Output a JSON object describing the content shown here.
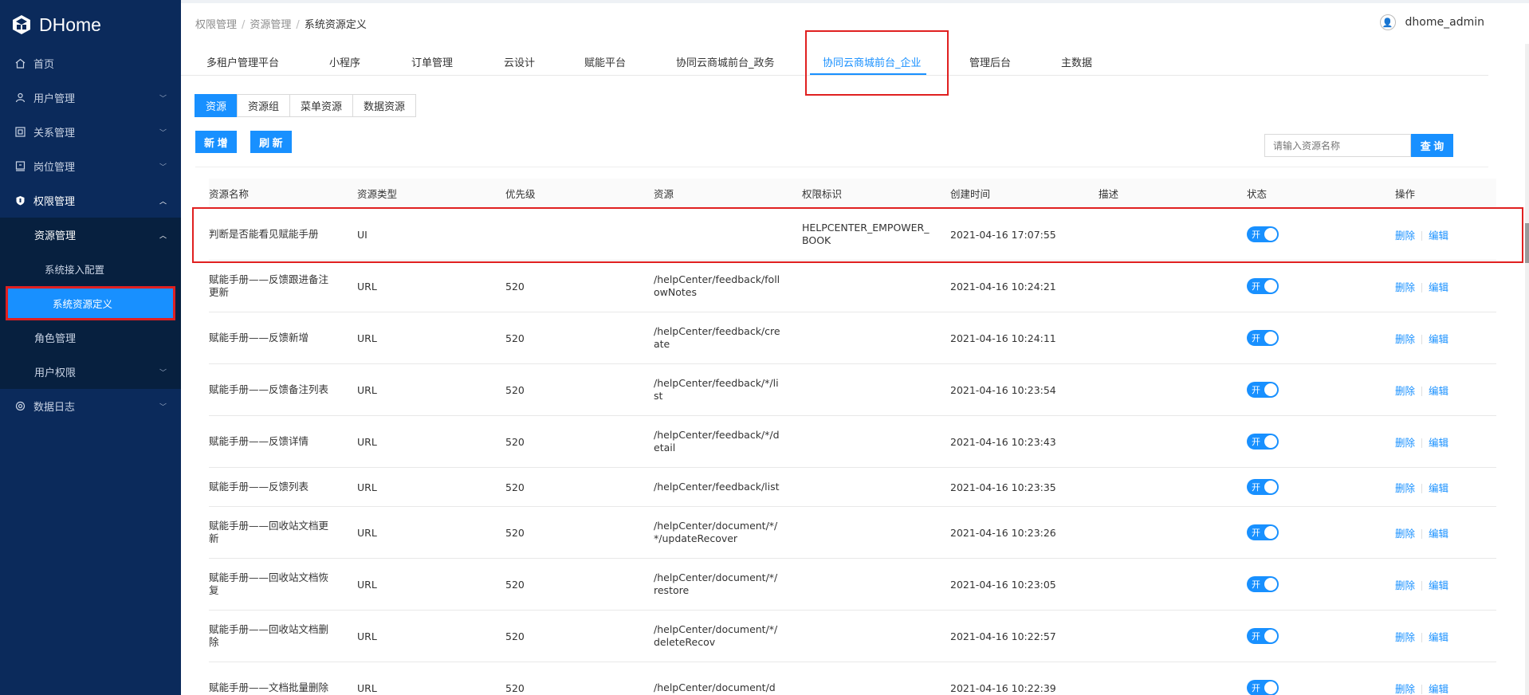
{
  "app": {
    "logo": "DHome"
  },
  "sidebar": {
    "items": [
      {
        "label": "首页",
        "icon": "home-icon"
      },
      {
        "label": "用户管理",
        "icon": "user-icon"
      },
      {
        "label": "关系管理",
        "icon": "relation-icon"
      },
      {
        "label": "岗位管理",
        "icon": "post-icon"
      },
      {
        "label": "权限管理",
        "icon": "shield-icon"
      },
      {
        "label": "资源管理"
      },
      {
        "label": "系统接入配置"
      },
      {
        "label": "系统资源定义"
      },
      {
        "label": "角色管理"
      },
      {
        "label": "用户权限"
      },
      {
        "label": "数据日志",
        "icon": "log-icon"
      }
    ]
  },
  "breadcrumb": {
    "b1": "权限管理",
    "b2": "资源管理",
    "b3": "系统资源定义"
  },
  "user": {
    "name": "dhome_admin"
  },
  "tabs": [
    "多租户管理平台",
    "小程序",
    "订单管理",
    "云设计",
    "赋能平台",
    "协同云商城前台_政务",
    "协同云商城前台_企业",
    "管理后台",
    "主数据"
  ],
  "segments": [
    "资源",
    "资源组",
    "菜单资源",
    "数据资源"
  ],
  "buttons": {
    "add": "新 增",
    "refresh": "刷 新",
    "query": "查 询"
  },
  "search": {
    "placeholder": "请输入资源名称"
  },
  "table": {
    "headers": [
      "资源名称",
      "资源类型",
      "优先级",
      "资源",
      "权限标识",
      "创建时间",
      "描述",
      "状态",
      "操作"
    ],
    "toggle_label": "开",
    "delete_label": "删除",
    "edit_label": "编辑",
    "rows": [
      {
        "name": [
          "判断是否能看见赋能手册"
        ],
        "type": "UI",
        "priority": "",
        "resource": [],
        "perm": [
          "HELPCENTER_EMPOWER_",
          "BOOK"
        ],
        "time": "2021-04-16 17:07:55"
      },
      {
        "name": [
          "赋能手册——反馈跟进备注",
          "更新"
        ],
        "type": "URL",
        "priority": "520",
        "resource": [
          "/helpCenter/feedback/foll",
          "owNotes"
        ],
        "perm": [],
        "time": "2021-04-16 10:24:21"
      },
      {
        "name": [
          "赋能手册——反馈新增"
        ],
        "type": "URL",
        "priority": "520",
        "resource": [
          "/helpCenter/feedback/cre",
          "ate"
        ],
        "perm": [],
        "time": "2021-04-16 10:24:11"
      },
      {
        "name": [
          "赋能手册——反馈备注列表"
        ],
        "type": "URL",
        "priority": "520",
        "resource": [
          "/helpCenter/feedback/*/li",
          "st"
        ],
        "perm": [],
        "time": "2021-04-16 10:23:54"
      },
      {
        "name": [
          "赋能手册——反馈详情"
        ],
        "type": "URL",
        "priority": "520",
        "resource": [
          "/helpCenter/feedback/*/d",
          "etail"
        ],
        "perm": [],
        "time": "2021-04-16 10:23:43"
      },
      {
        "name": [
          "赋能手册——反馈列表"
        ],
        "type": "URL",
        "priority": "520",
        "resource": [
          "/helpCenter/feedback/list"
        ],
        "perm": [],
        "time": "2021-04-16 10:23:35"
      },
      {
        "name": [
          "赋能手册——回收站文档更",
          "新"
        ],
        "type": "URL",
        "priority": "520",
        "resource": [
          "/helpCenter/document/*/",
          "*/updateRecover"
        ],
        "perm": [],
        "time": "2021-04-16 10:23:26"
      },
      {
        "name": [
          "赋能手册——回收站文档恢",
          "复"
        ],
        "type": "URL",
        "priority": "520",
        "resource": [
          "/helpCenter/document/*/",
          "restore"
        ],
        "perm": [],
        "time": "2021-04-16 10:23:05"
      },
      {
        "name": [
          "赋能手册——回收站文档删",
          "除"
        ],
        "type": "URL",
        "priority": "520",
        "resource": [
          "/helpCenter/document/*/",
          "deleteRecov"
        ],
        "perm": [],
        "time": "2021-04-16 10:22:57"
      },
      {
        "name": [
          "赋能手册——文档批量删除"
        ],
        "type": "URL",
        "priority": "520",
        "resource": [
          "/helpCenter/document/d"
        ],
        "perm": [],
        "time": "2021-04-16 10:22:39"
      }
    ]
  }
}
